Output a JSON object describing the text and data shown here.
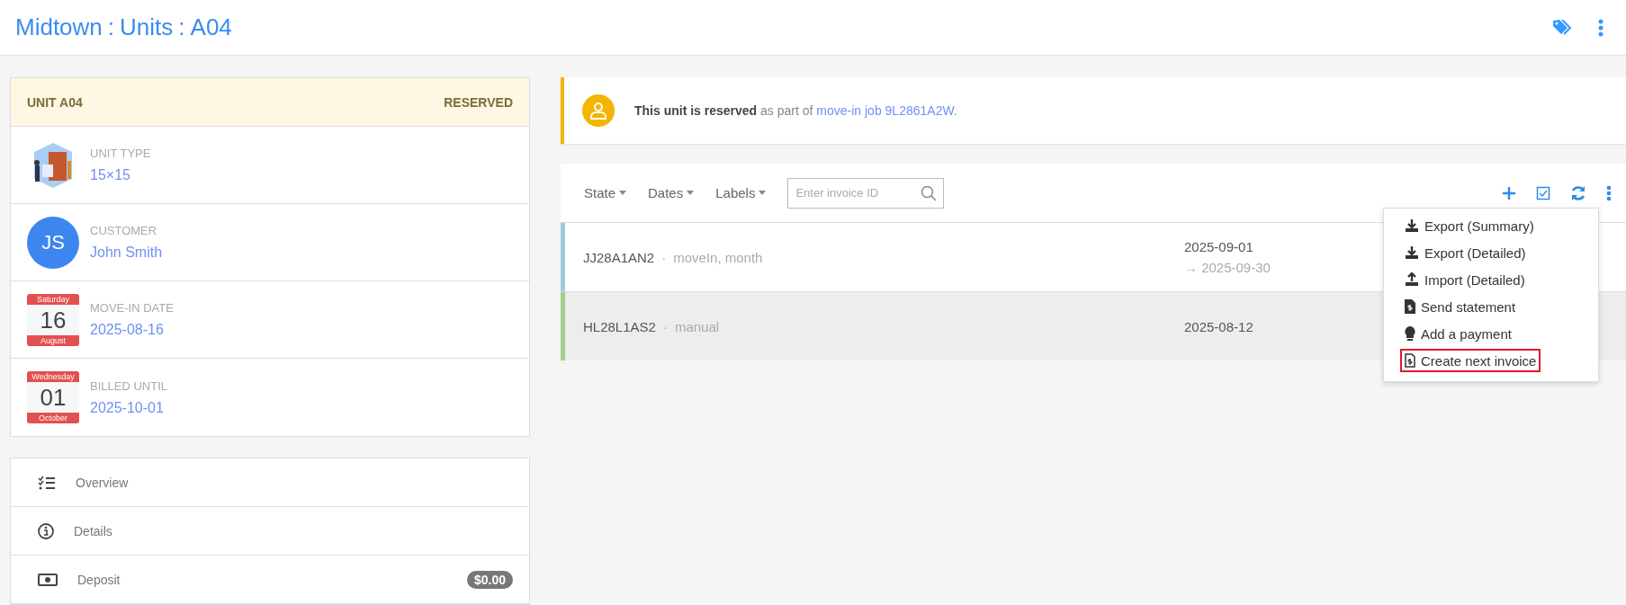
{
  "breadcrumb": [
    {
      "label": "Midtown"
    },
    {
      "label": "Units"
    },
    {
      "label": "A04"
    }
  ],
  "breadcrumb_separator": ":",
  "unit_card": {
    "title": "UNIT A04",
    "status": "RESERVED",
    "fields": [
      {
        "kind": "unit",
        "label": "UNIT TYPE",
        "value": "15×15"
      },
      {
        "kind": "avatar",
        "label": "CUSTOMER",
        "value": "John Smith",
        "initials": "JS"
      },
      {
        "kind": "calendar",
        "label": "MOVE-IN DATE",
        "value": "2025-08-16",
        "weekday": "Saturday",
        "day": "16",
        "month": "August"
      },
      {
        "kind": "calendar",
        "label": "BILLED UNTIL",
        "value": "2025-10-01",
        "weekday": "Wednesday",
        "day": "01",
        "month": "October"
      }
    ]
  },
  "nav": [
    {
      "kind": "overview",
      "label": "Overview"
    },
    {
      "kind": "details",
      "label": "Details"
    },
    {
      "kind": "deposit",
      "label": "Deposit",
      "badge": "$0.00"
    }
  ],
  "banner": {
    "text": "**This unit is reserved** as part of ",
    "link": "move-in job 9L2861A2W",
    "suffix": "."
  },
  "filters": [
    {
      "label": "State"
    },
    {
      "label": "Dates"
    },
    {
      "label": "Labels"
    }
  ],
  "search": {
    "placeholder": "Enter invoice ID"
  },
  "invoices": [
    {
      "id": "JJ28A1AN2",
      "separator": "·",
      "tags": "moveIn, month",
      "date": "2025-09-01",
      "end": "→ 2025-09-30",
      "color": "#9ecae1",
      "selected": false
    },
    {
      "id": "HL28L1AS2",
      "separator": "·",
      "tags": "manual",
      "date": "2025-08-12",
      "color": "#a5cd8b",
      "selected": true
    }
  ],
  "menu": [
    {
      "kind": "download",
      "label": "Export (Summary)",
      "highlighted": false
    },
    {
      "kind": "download",
      "label": "Export (Detailed)",
      "highlighted": false
    },
    {
      "kind": "upload",
      "label": "Import (Detailed)",
      "highlighted": false
    },
    {
      "kind": "statement",
      "label": "Send statement",
      "highlighted": false
    },
    {
      "kind": "payment",
      "label": "Add a payment",
      "highlighted": false
    },
    {
      "kind": "invoice",
      "label": "Create next invoice",
      "highlighted": true
    }
  ]
}
